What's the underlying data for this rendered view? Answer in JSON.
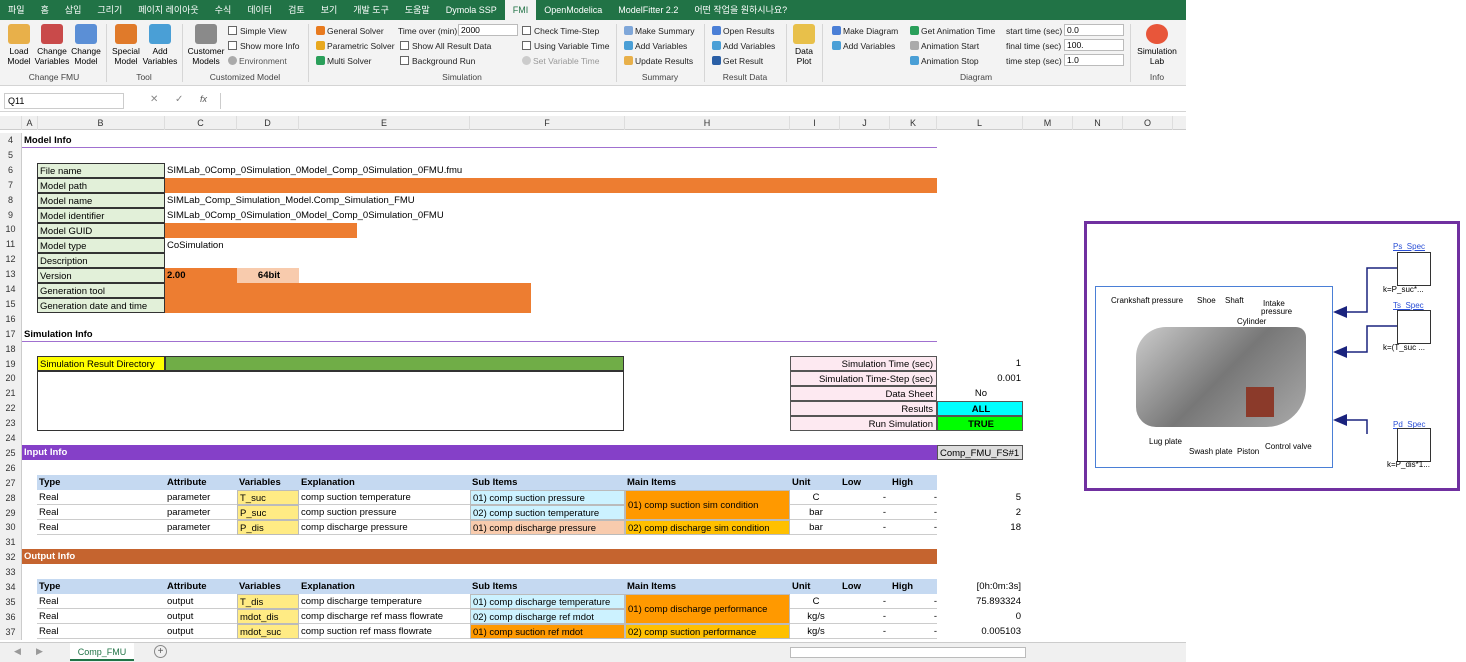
{
  "tabs": [
    "파일",
    "홈",
    "삽입",
    "그리기",
    "페이지 레이아웃",
    "수식",
    "데이터",
    "검토",
    "보기",
    "개발 도구",
    "도움말",
    "Dymola SSP",
    "FMI",
    "OpenModelica",
    "ModelFitter 2.2",
    "어떤 작업을 원하시나요?"
  ],
  "ribbon": {
    "load_model": "Load Model",
    "change_variables": "Change Variables",
    "change_model": "Change Model",
    "grp_change_fmu": "Change FMU",
    "special_model": "Special Model",
    "add_variables": "Add Variables",
    "grp_tool": "Tool",
    "customer_models": "Customer Models",
    "simple_view": "Simple View",
    "show_more_info": "Show more Info",
    "environment": "Environment",
    "grp_customized": "Customized Model",
    "general_solver": "General Solver",
    "parametric_solver": "Parametric Solver",
    "multi_solver": "Multi Solver",
    "time_over_label": "Time over (min)",
    "time_over_value": "2000",
    "show_all_result": "Show All Result Data",
    "background_run": "Background Run",
    "check_time_step": "Check Time-Step",
    "using_variable_time": "Using Variable Time",
    "set_variable_time": "Set Variable Time",
    "grp_simulation": "Simulation",
    "make_summary": "Make Summary",
    "add_variables2": "Add Variables",
    "update_results": "Update Results",
    "grp_summary": "Summary",
    "open_results": "Open Results",
    "add_variables3": "Add Variables",
    "get_result": "Get Result",
    "grp_result_data": "Result Data",
    "data_plot": "Data Plot",
    "make_diagram": "Make Diagram",
    "add_variables4": "Add Variables",
    "get_animation_time": "Get Animation Time",
    "animation_start": "Animation Start",
    "animation_stop": "Animation Stop",
    "start_time_label": "start time (sec)",
    "start_time_value": "0.0",
    "final_time_label": "final time (sec)",
    "final_time_value": "100.",
    "time_step_label": "time step (sec)",
    "time_step_value": "1.0",
    "grp_diagram": "Diagram",
    "simulation_lab": "Simulation Lab",
    "grp_info": "Info"
  },
  "namebox": "Q11",
  "columns": [
    "A",
    "B",
    "C",
    "D",
    "E",
    "F",
    "H",
    "I",
    "J",
    "K",
    "L",
    "M",
    "N",
    "O"
  ],
  "rows": [
    "4",
    "5",
    "6",
    "7",
    "8",
    "9",
    "10",
    "11",
    "12",
    "13",
    "14",
    "15",
    "16",
    "17",
    "18",
    "19",
    "20",
    "21",
    "22",
    "23",
    "24",
    "25",
    "26",
    "27",
    "28",
    "29",
    "30",
    "31",
    "32",
    "33",
    "34",
    "35",
    "36",
    "37"
  ],
  "model_info": {
    "title": "Model Info",
    "file_name_label": "File name",
    "file_name": "SIMLab_0Comp_0Simulation_0Model_Comp_0Simulation_0FMU.fmu",
    "model_path_label": "Model path",
    "model_name_label": "Model name",
    "model_name": "SIMLab_Comp_Simulation_Model.Comp_Simulation_FMU",
    "model_identifier_label": "Model identifier",
    "model_identifier": "SIMLab_0Comp_0Simulation_0Model_Comp_0Simulation_0FMU",
    "model_guid_label": "Model GUID",
    "model_type_label": "Model type",
    "model_type": "CoSimulation",
    "description_label": "Description",
    "version_label": "Version",
    "version": "2.00",
    "bits": "64bit",
    "generation_tool_label": "Generation tool",
    "generation_date_label": "Generation date and time"
  },
  "sim_info": {
    "title": "Simulation Info",
    "result_dir_label": "Simulation Result Directory",
    "sim_time_label": "Simulation Time (sec)",
    "sim_time": "1",
    "sim_step_label": "Simulation Time-Step (sec)",
    "sim_step": "0.001",
    "data_sheet_label": "Data Sheet",
    "data_sheet": "No",
    "results_label": "Results",
    "results": "ALL",
    "run_label": "Run Simulation",
    "run": "TRUE"
  },
  "input_info": {
    "title": "Input Info",
    "tag": "Comp_FMU_FS#1",
    "headers": [
      "Type",
      "Attribute",
      "Variables",
      "Explanation",
      "Sub Items",
      "Main Items",
      "Unit",
      "Low",
      "High"
    ],
    "rows": [
      {
        "type": "Real",
        "attr": "parameter",
        "var": "T_suc",
        "expl": "comp suction temperature",
        "sub": "01) comp suction pressure",
        "main": "01) comp suction sim condition",
        "unit": "C",
        "low": "-",
        "high": "-",
        "val": "5"
      },
      {
        "type": "Real",
        "attr": "parameter",
        "var": "P_suc",
        "expl": "comp suction pressure",
        "sub": "02) comp suction temperature",
        "main": "",
        "unit": "bar",
        "low": "-",
        "high": "-",
        "val": "2"
      },
      {
        "type": "Real",
        "attr": "parameter",
        "var": "P_dis",
        "expl": "comp discharge pressure",
        "sub": "01) comp discharge pressure",
        "main": "02) comp discharge sim condition",
        "unit": "bar",
        "low": "-",
        "high": "-",
        "val": "18"
      }
    ]
  },
  "output_info": {
    "title": "Output Info",
    "time": "[0h:0m:3s]",
    "headers": [
      "Type",
      "Attribute",
      "Variables",
      "Explanation",
      "Sub Items",
      "Main Items",
      "Unit",
      "Low",
      "High"
    ],
    "rows": [
      {
        "type": "Real",
        "attr": "output",
        "var": "T_dis",
        "expl": "comp discharge temperature",
        "sub": "01) comp discharge temperature",
        "main": "01) comp discharge performance",
        "unit": "C",
        "low": "-",
        "high": "-",
        "val": "75.893324"
      },
      {
        "type": "Real",
        "attr": "output",
        "var": "mdot_dis",
        "expl": "comp discharge ref mass flowrate",
        "sub": "02) comp discharge ref mdot",
        "main": "",
        "unit": "kg/s",
        "low": "-",
        "high": "-",
        "val": "0"
      },
      {
        "type": "Real",
        "attr": "output",
        "var": "mdot_suc",
        "expl": "comp suction ref mass flowrate",
        "sub": "01) comp suction ref mdot",
        "main": "02) comp suction performance",
        "unit": "kg/s",
        "low": "-",
        "high": "-",
        "val": "0.005103"
      }
    ]
  },
  "sheet_tab": "Comp_FMU",
  "diagram": {
    "ps_spec": "Ps_Spec",
    "ps_k": "k=P_suc*...",
    "ts_spec": "Ts_Spec",
    "ts_k": "k=(T_suc ...",
    "pd_spec": "Pd_Spec",
    "pd_k": "k=P_dis*1...",
    "crankshaft": "Crankshaft pressure",
    "shoe": "Shoe",
    "shaft": "Shaft",
    "intake": "Intake",
    "pressure": "pressure",
    "cylinder": "Cylinder",
    "lug_plate": "Lug plate",
    "swash_plate": "Swash plate",
    "piston": "Piston",
    "control_valve": "Control valve"
  }
}
